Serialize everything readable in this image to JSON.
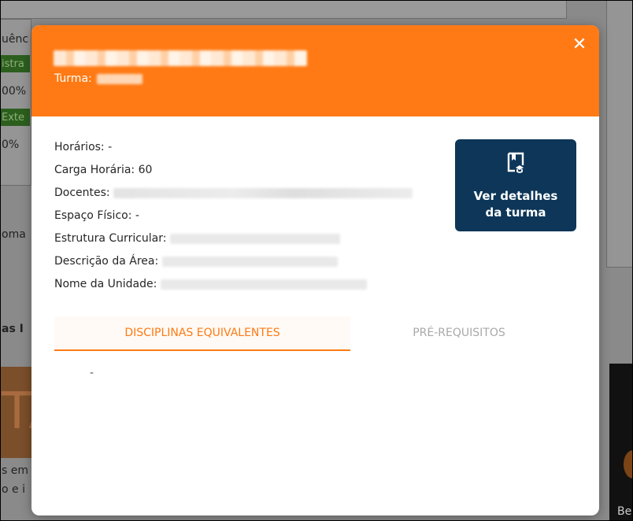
{
  "background": {
    "fragments": [
      "uênc",
      "istra",
      "00%",
      "Exte",
      "0%",
      "oma",
      "as I",
      "TA",
      "s em",
      "o e i",
      "Be"
    ]
  },
  "modal": {
    "close_icon": "close-icon",
    "turma_label": "Turma:",
    "fields": [
      {
        "label": "Horários:",
        "value": "-"
      },
      {
        "label": "Carga Horária:",
        "value": "60"
      },
      {
        "label": "Docentes:",
        "value": ""
      },
      {
        "label": "Espaço Físico:",
        "value": "-"
      },
      {
        "label": "Estrutura Curricular:",
        "value": ""
      },
      {
        "label": "Descrição da Área:",
        "value": ""
      },
      {
        "label": "Nome da Unidade:",
        "value": ""
      }
    ],
    "details_button": {
      "line1": "Ver detalhes",
      "line2": "da turma",
      "icon": "book-class-icon"
    },
    "tabs": [
      {
        "label": "DISCIPLINAS EQUIVALENTES",
        "active": true
      },
      {
        "label": "PRÉ-REQUISITOS",
        "active": false
      }
    ],
    "tab_content": "-"
  },
  "colors": {
    "header": "#ff7a14",
    "button": "#0d3658",
    "active_tab": "#ff7a14"
  }
}
